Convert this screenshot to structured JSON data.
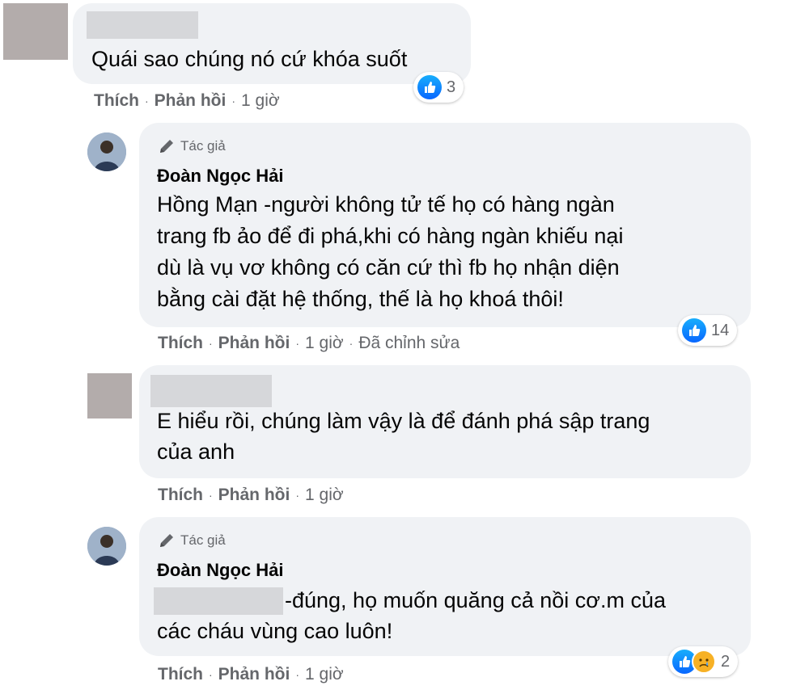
{
  "comments": [
    {
      "text": "Quái sao chúng nó cứ khóa suốt",
      "actions": {
        "like": "Thích",
        "reply": "Phản hồi",
        "time": "1 giờ"
      },
      "reactions": {
        "count": "3",
        "types": [
          "like-icon"
        ]
      }
    },
    {
      "badge": "Tác giả",
      "author": "Đoàn Ngọc Hải",
      "lines": [
        "Hồng Mạn -người không tử tế họ có hàng ngàn",
        "trang fb ảo để đi phá,khi có hàng ngàn khiếu nại",
        "dù là vụ vơ không có căn cứ thì fb họ nhận diện",
        "bằng cài đặt hệ thống, thế là họ khoá thôi!"
      ],
      "actions": {
        "like": "Thích",
        "reply": "Phản hồi",
        "time": "1 giờ",
        "edited": "Đã chỉnh sửa"
      },
      "reactions": {
        "count": "14",
        "types": [
          "like-icon"
        ]
      }
    },
    {
      "lines": [
        "E hiểu rồi, chúng làm vậy là để đánh phá sập trang",
        "của anh"
      ],
      "actions": {
        "like": "Thích",
        "reply": "Phản hồi",
        "time": "1 giờ"
      }
    },
    {
      "badge": "Tác giả",
      "author": "Đoàn Ngọc Hải",
      "lines": [
        "-đúng, họ muốn quăng cả nồi cơ.m của",
        "các cháu vùng cao luôn!"
      ],
      "actions": {
        "like": "Thích",
        "reply": "Phản hồi",
        "time": "1 giờ"
      },
      "reactions": {
        "count": "2",
        "types": [
          "like-icon",
          "sad-icon"
        ]
      }
    }
  ],
  "colors": {
    "bubble": "#f0f2f5",
    "meta": "#65676b",
    "like": "#0866ff",
    "sad": "#f7b125"
  }
}
